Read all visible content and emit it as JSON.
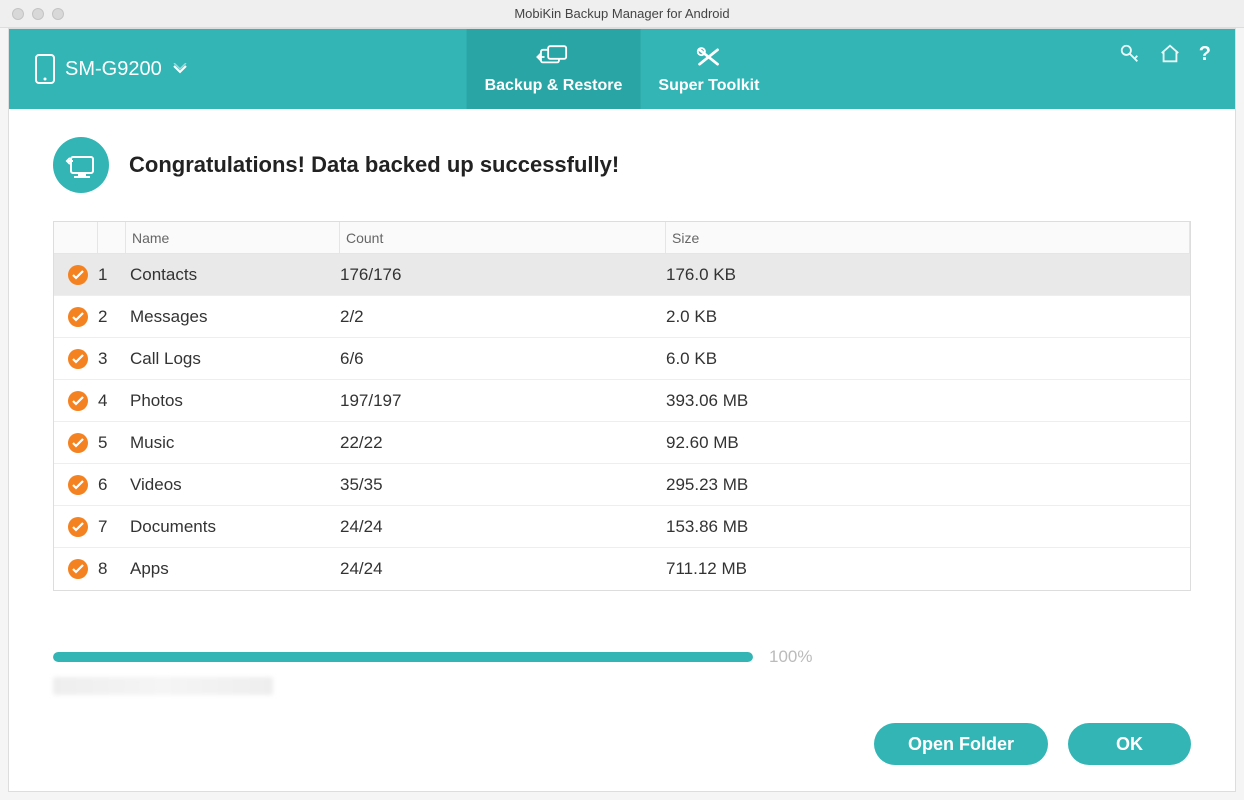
{
  "titlebar": {
    "title": "MobiKin Backup Manager for Android"
  },
  "header": {
    "device_label": "SM-G9200",
    "tabs": [
      {
        "label": "Backup & Restore",
        "active": true
      },
      {
        "label": "Super Toolkit",
        "active": false
      }
    ],
    "help_label": "?"
  },
  "success": {
    "message": "Congratulations! Data backed up successfully!"
  },
  "table": {
    "columns": {
      "name": "Name",
      "count": "Count",
      "size": "Size"
    },
    "rows": [
      {
        "idx": "1",
        "name": "Contacts",
        "count": "176/176",
        "size": "176.0 KB",
        "selected": true
      },
      {
        "idx": "2",
        "name": "Messages",
        "count": "2/2",
        "size": "2.0 KB",
        "selected": false
      },
      {
        "idx": "3",
        "name": "Call Logs",
        "count": "6/6",
        "size": "6.0 KB",
        "selected": false
      },
      {
        "idx": "4",
        "name": "Photos",
        "count": "197/197",
        "size": "393.06 MB",
        "selected": false
      },
      {
        "idx": "5",
        "name": "Music",
        "count": "22/22",
        "size": "92.60 MB",
        "selected": false
      },
      {
        "idx": "6",
        "name": "Videos",
        "count": "35/35",
        "size": "295.23 MB",
        "selected": false
      },
      {
        "idx": "7",
        "name": "Documents",
        "count": "24/24",
        "size": "153.86 MB",
        "selected": false
      },
      {
        "idx": "8",
        "name": "Apps",
        "count": "24/24",
        "size": "711.12 MB",
        "selected": false
      }
    ]
  },
  "progress": {
    "percent": 100,
    "label": "100%"
  },
  "footer": {
    "open_folder": "Open Folder",
    "ok": "OK"
  },
  "colors": {
    "accent": "#33b5b5",
    "check": "#f58220"
  }
}
